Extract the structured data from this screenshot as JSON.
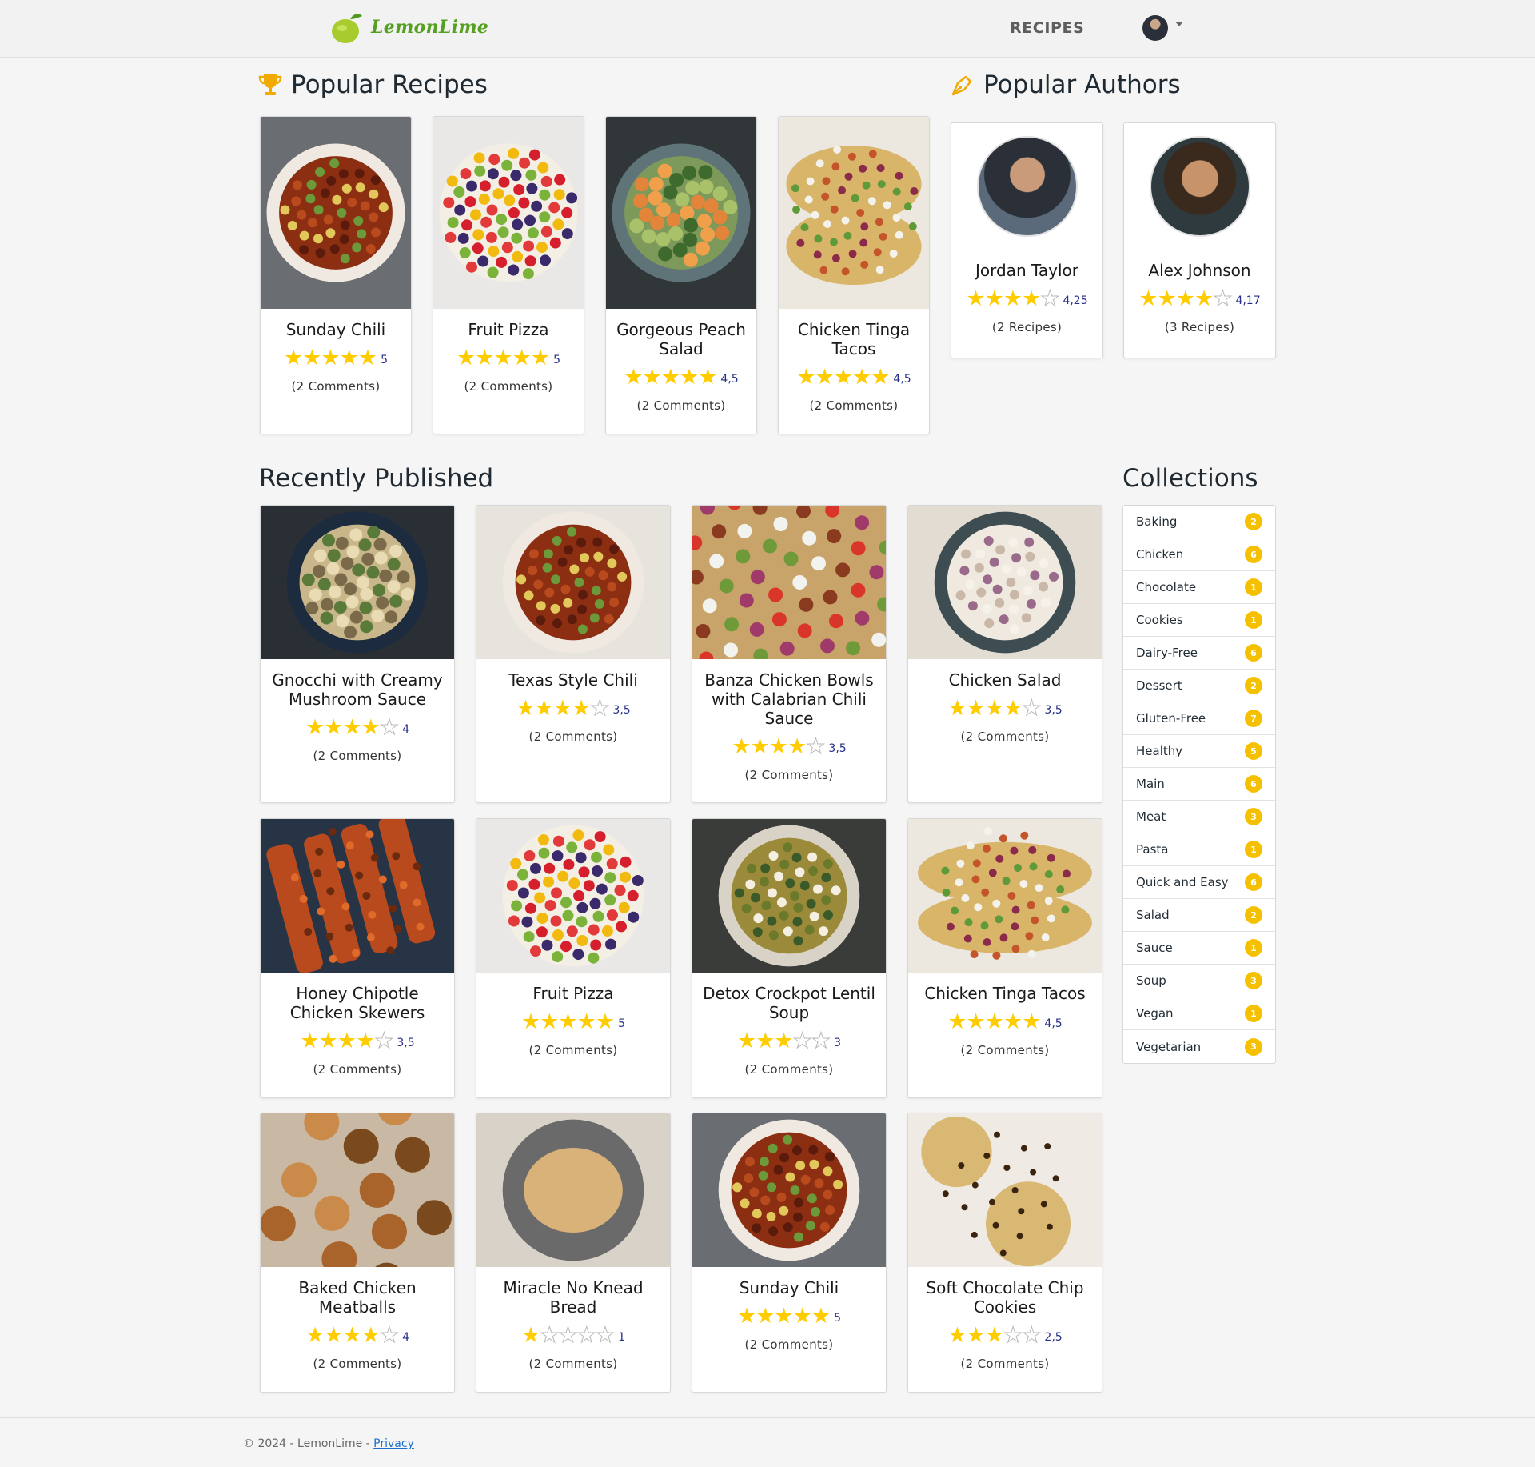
{
  "brand": {
    "name": "LemonLime"
  },
  "nav": {
    "recipes": "RECIPES"
  },
  "sections": {
    "popular_recipes": "Popular Recipes",
    "popular_authors": "Popular Authors",
    "recently_published": "Recently Published",
    "collections": "Collections"
  },
  "popular_recipes": [
    {
      "title": "Sunday Chili",
      "rating": "5",
      "stars": 5,
      "comments": "(2 Comments)",
      "image": "chili"
    },
    {
      "title": "Fruit Pizza",
      "rating": "5",
      "stars": 5,
      "comments": "(2 Comments)",
      "image": "fruit-pizza"
    },
    {
      "title": "Gorgeous Peach Salad",
      "rating": "4,5",
      "stars": 5,
      "comments": "(2 Comments)",
      "image": "peach-salad"
    },
    {
      "title": "Chicken Tinga Tacos",
      "rating": "4,5",
      "stars": 5,
      "comments": "(2 Comments)",
      "image": "tacos"
    }
  ],
  "popular_authors": [
    {
      "name": "Jordan Taylor",
      "rating": "4,25",
      "stars": 4,
      "recipes": "(2 Recipes)"
    },
    {
      "name": "Alex Johnson",
      "rating": "4,17",
      "stars": 4,
      "recipes": "(3 Recipes)"
    }
  ],
  "recent": [
    {
      "title": "Gnocchi with Creamy Mushroom Sauce",
      "rating": "4",
      "stars": 4,
      "comments": "(2 Comments)",
      "image": "gnocchi"
    },
    {
      "title": "Texas Style Chili",
      "rating": "3,5",
      "stars": 4,
      "comments": "(2 Comments)",
      "image": "texas-chili"
    },
    {
      "title": "Banza Chicken Bowls with Calabrian Chili Sauce",
      "rating": "3,5",
      "stars": 4,
      "comments": "(2 Comments)",
      "image": "banza-bowl"
    },
    {
      "title": "Chicken Salad",
      "rating": "3,5",
      "stars": 4,
      "comments": "(2 Comments)",
      "image": "chicken-salad"
    },
    {
      "title": "Honey Chipotle Chicken Skewers",
      "rating": "3,5",
      "stars": 4,
      "comments": "(2 Comments)",
      "image": "skewers"
    },
    {
      "title": "Fruit Pizza",
      "rating": "5",
      "stars": 5,
      "comments": "(2 Comments)",
      "image": "fruit-pizza"
    },
    {
      "title": "Detox Crockpot Lentil Soup",
      "rating": "3",
      "stars": 3,
      "comments": "(2 Comments)",
      "image": "lentil-soup"
    },
    {
      "title": "Chicken Tinga Tacos",
      "rating": "4,5",
      "stars": 5,
      "comments": "(2 Comments)",
      "image": "tacos"
    },
    {
      "title": "Baked Chicken Meatballs",
      "rating": "4",
      "stars": 4,
      "comments": "(2 Comments)",
      "image": "meatballs"
    },
    {
      "title": "Miracle No Knead Bread",
      "rating": "1",
      "stars": 1,
      "comments": "(2 Comments)",
      "image": "bread"
    },
    {
      "title": "Sunday Chili",
      "rating": "5",
      "stars": 5,
      "comments": "(2 Comments)",
      "image": "chili"
    },
    {
      "title": "Soft Chocolate Chip Cookies",
      "rating": "2,5",
      "stars": 3,
      "comments": "(2 Comments)",
      "image": "cookies"
    }
  ],
  "collections": [
    {
      "name": "Baking",
      "count": "2"
    },
    {
      "name": "Chicken",
      "count": "6"
    },
    {
      "name": "Chocolate",
      "count": "1"
    },
    {
      "name": "Cookies",
      "count": "1"
    },
    {
      "name": "Dairy-Free",
      "count": "6"
    },
    {
      "name": "Dessert",
      "count": "2"
    },
    {
      "name": "Gluten-Free",
      "count": "7"
    },
    {
      "name": "Healthy",
      "count": "5"
    },
    {
      "name": "Main",
      "count": "6"
    },
    {
      "name": "Meat",
      "count": "3"
    },
    {
      "name": "Pasta",
      "count": "1"
    },
    {
      "name": "Quick and Easy",
      "count": "6"
    },
    {
      "name": "Salad",
      "count": "2"
    },
    {
      "name": "Sauce",
      "count": "1"
    },
    {
      "name": "Soup",
      "count": "3"
    },
    {
      "name": "Vegan",
      "count": "1"
    },
    {
      "name": "Vegetarian",
      "count": "3"
    }
  ],
  "footer": {
    "text": "© 2024 - LemonLime - ",
    "privacy": "Privacy"
  },
  "colors": {
    "star": "#ffcc00",
    "badge": "#f5c000",
    "brand_green": "#55a020",
    "rating_text": "#26308a",
    "icon_gold": "#f2a900"
  }
}
